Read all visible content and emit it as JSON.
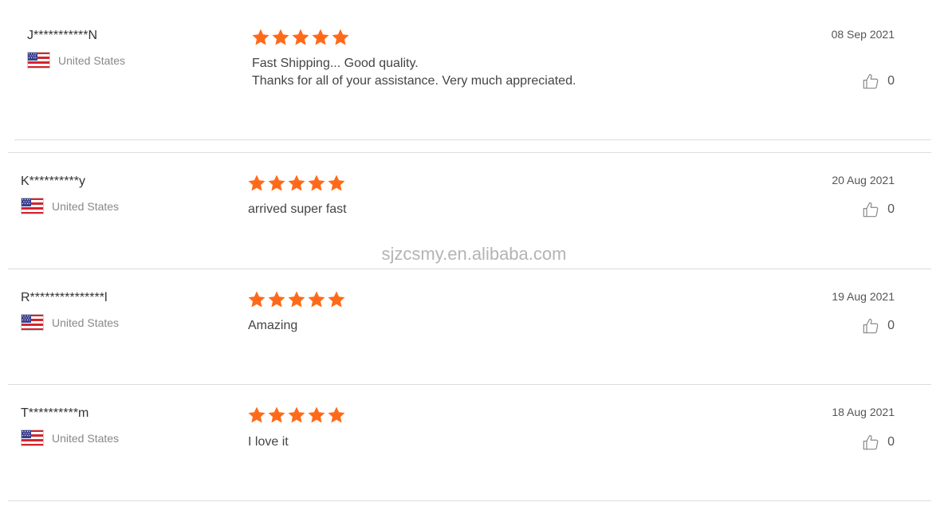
{
  "watermark": "sjzcsmy.en.alibaba.com",
  "colors": {
    "star": "#ff6a1a",
    "divider": "#dcdcdc"
  },
  "reviews": [
    {
      "name": "J***********N",
      "country": "United States",
      "flag_icon": "us-flag-icon",
      "rating": 5,
      "content_lines": [
        "Fast Shipping... Good quality.",
        "Thanks for all of your assistance. Very much appreciated."
      ],
      "date": "08 Sep 2021",
      "likes": "0"
    },
    {
      "name": "K**********y",
      "country": "United States",
      "flag_icon": "us-flag-icon",
      "rating": 5,
      "content_lines": [
        "arrived super fast"
      ],
      "date": "20 Aug 2021",
      "likes": "0"
    },
    {
      "name": "R***************l",
      "country": "United States",
      "flag_icon": "us-flag-icon",
      "rating": 5,
      "content_lines": [
        "Amazing"
      ],
      "date": "19 Aug 2021",
      "likes": "0"
    },
    {
      "name": "T**********m",
      "country": "United States",
      "flag_icon": "us-flag-icon",
      "rating": 5,
      "content_lines": [
        "I love it"
      ],
      "date": "18 Aug 2021",
      "likes": "0"
    }
  ]
}
